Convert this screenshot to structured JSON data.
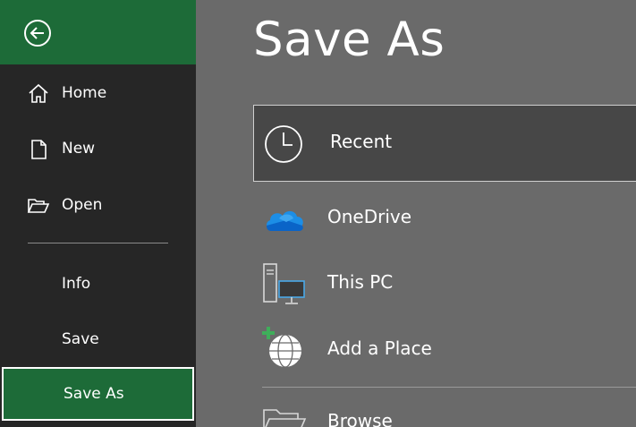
{
  "sidebar": {
    "back_label": "Back",
    "items": [
      {
        "label": "Home",
        "icon": "home-icon"
      },
      {
        "label": "New",
        "icon": "new-document-icon"
      },
      {
        "label": "Open",
        "icon": "open-folder-icon"
      },
      {
        "label": "Info"
      },
      {
        "label": "Save"
      },
      {
        "label": "Save As",
        "selected": true
      }
    ]
  },
  "main": {
    "title": "Save As",
    "locations": [
      {
        "label": "Recent",
        "icon": "clock-icon",
        "selected": true
      },
      {
        "label": "OneDrive",
        "icon": "onedrive-cloud-icon"
      },
      {
        "label": "This PC",
        "icon": "this-pc-icon"
      },
      {
        "label": "Add a Place",
        "icon": "add-place-globe-icon"
      },
      {
        "label": "Browse",
        "icon": "browse-folder-icon"
      }
    ]
  },
  "colors": {
    "accent_green": "#1d6b38",
    "sidebar_bg": "#262626",
    "main_bg": "#6a6a6a",
    "selected_bg": "#474747",
    "onedrive_blue": "#0a64c8"
  }
}
